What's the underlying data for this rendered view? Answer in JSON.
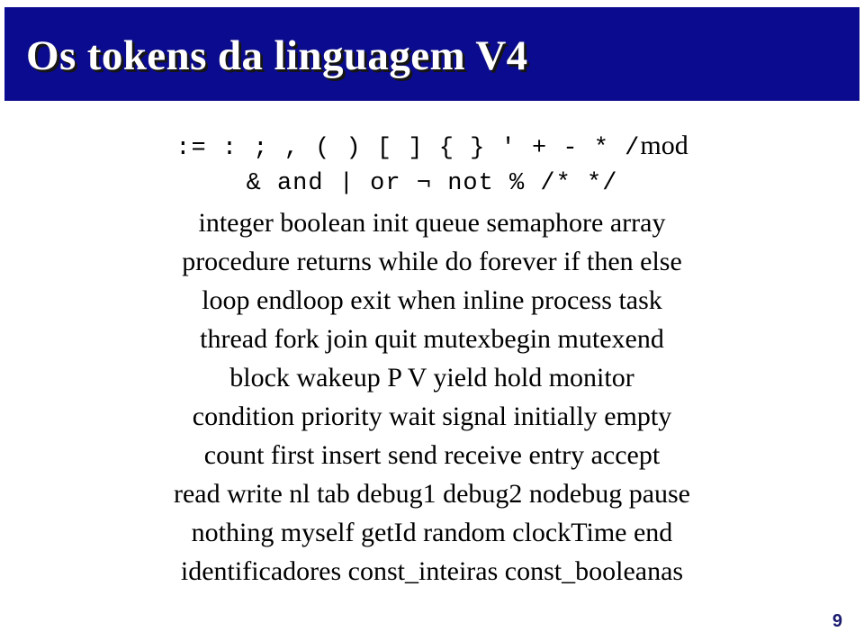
{
  "slide": {
    "title": "Os tokens da linguagem V4",
    "page_number": "9",
    "colors": {
      "banner_background": "#0b0b8f",
      "title_text": "#ffffff",
      "title_shadow": "#151515",
      "body_text": "#000000",
      "page_number": "#1a1a6e",
      "slide_background": "#ffffff"
    }
  },
  "token_lines": [
    {
      "id": "operators-punctuation",
      "style": "mixed",
      "mono_part": ":=  :  ;  ,  (  )  [  ]  {  }  '  +  -  *  /",
      "serif_part": "mod"
    },
    {
      "id": "logical-operators-comments",
      "style": "mono",
      "text": "&  and  |  or  ¬  not  %  /*  */"
    },
    {
      "id": "types-and-structures",
      "style": "serif",
      "text": "integer  boolean  init  queue  semaphore  array"
    },
    {
      "id": "control-flow-one",
      "style": "serif",
      "text": "procedure  returns  while  do  forever  if  then  else"
    },
    {
      "id": "control-flow-two",
      "style": "serif",
      "text": "loop  endloop  exit  when  inline  process  task"
    },
    {
      "id": "concurrency-one",
      "style": "serif",
      "text": "thread  fork  join  quit  mutexbegin  mutexend"
    },
    {
      "id": "concurrency-two",
      "style": "serif",
      "text": "block  wakeup  P  V  yield  hold  monitor"
    },
    {
      "id": "synchronization",
      "style": "serif",
      "text": "condition  priority  wait  signal  initially  empty"
    },
    {
      "id": "messaging",
      "style": "serif",
      "text": "count  first  insert  send  receive  entry  accept"
    },
    {
      "id": "io-and-debug",
      "style": "serif",
      "text": "read  write  nl  tab  debug1  debug2  nodebug  pause"
    },
    {
      "id": "builtins",
      "style": "serif",
      "text": "nothing  myself  getId  random  clockTime  end"
    },
    {
      "id": "literals",
      "style": "serif",
      "text": "identificadores  const_inteiras  const_booleanas"
    }
  ]
}
